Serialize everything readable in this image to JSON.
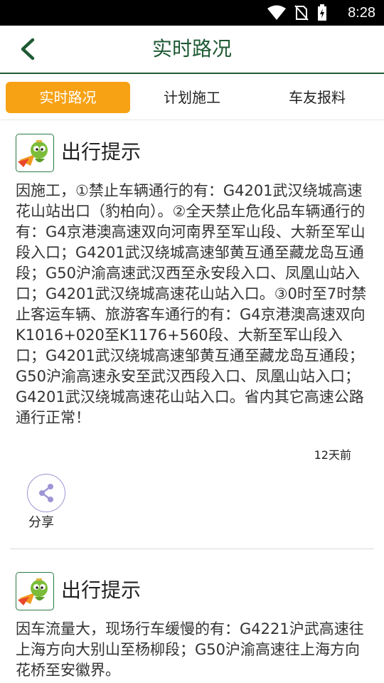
{
  "status_bar": {
    "time": "8:28"
  },
  "app_bar": {
    "title": "实时路况"
  },
  "tabs": [
    {
      "label": "实时路况",
      "active": true
    },
    {
      "label": "计划施工",
      "active": false
    },
    {
      "label": "车友报料",
      "active": false
    }
  ],
  "posts": [
    {
      "title": "出行提示",
      "text": "因施工，①禁止车辆通行的有：G4201武汉绕城高速花山站出口（豹柏向）。②全天禁止危化品车辆通行的有：G4京港澳高速双向河南界至军山段、大新至军山段入口；G4201武汉绕城高速邹黄互通至藏龙岛互通段；G50沪渝高速武汉西至永安段入口、凤凰山站入口；G4201武汉绕城高速花山站入口。③0时至7时禁止客运车辆、旅游客车通行的有：G4京港澳高速双向K1016+020至K1176+560段、大新至军山段入口；G4201武汉绕城高速邹黄互通至藏龙岛互通段；G50沪渝高速永安至武汉西段入口、凤凰山站入口；G4201武汉绕城高速花山站入口。省内其它高速公路通行正常！",
      "time_ago": "12天前",
      "share_label": "分享"
    },
    {
      "title": "出行提示",
      "text": "因车流量大，现场行车缓慢的有：G4221沪武高速往上海方向大别山至杨柳段；G50沪渝高速往上海方向花桥至安徽界。"
    }
  ],
  "colors": {
    "accent": "#f7a215",
    "brand_green": "#1f5a34",
    "share_ring": "#9d95d4"
  },
  "icons": [
    "wifi-icon",
    "no-sim-icon",
    "battery-charging-icon",
    "back-arrow-icon",
    "mascot-avatar-icon",
    "share-icon"
  ]
}
